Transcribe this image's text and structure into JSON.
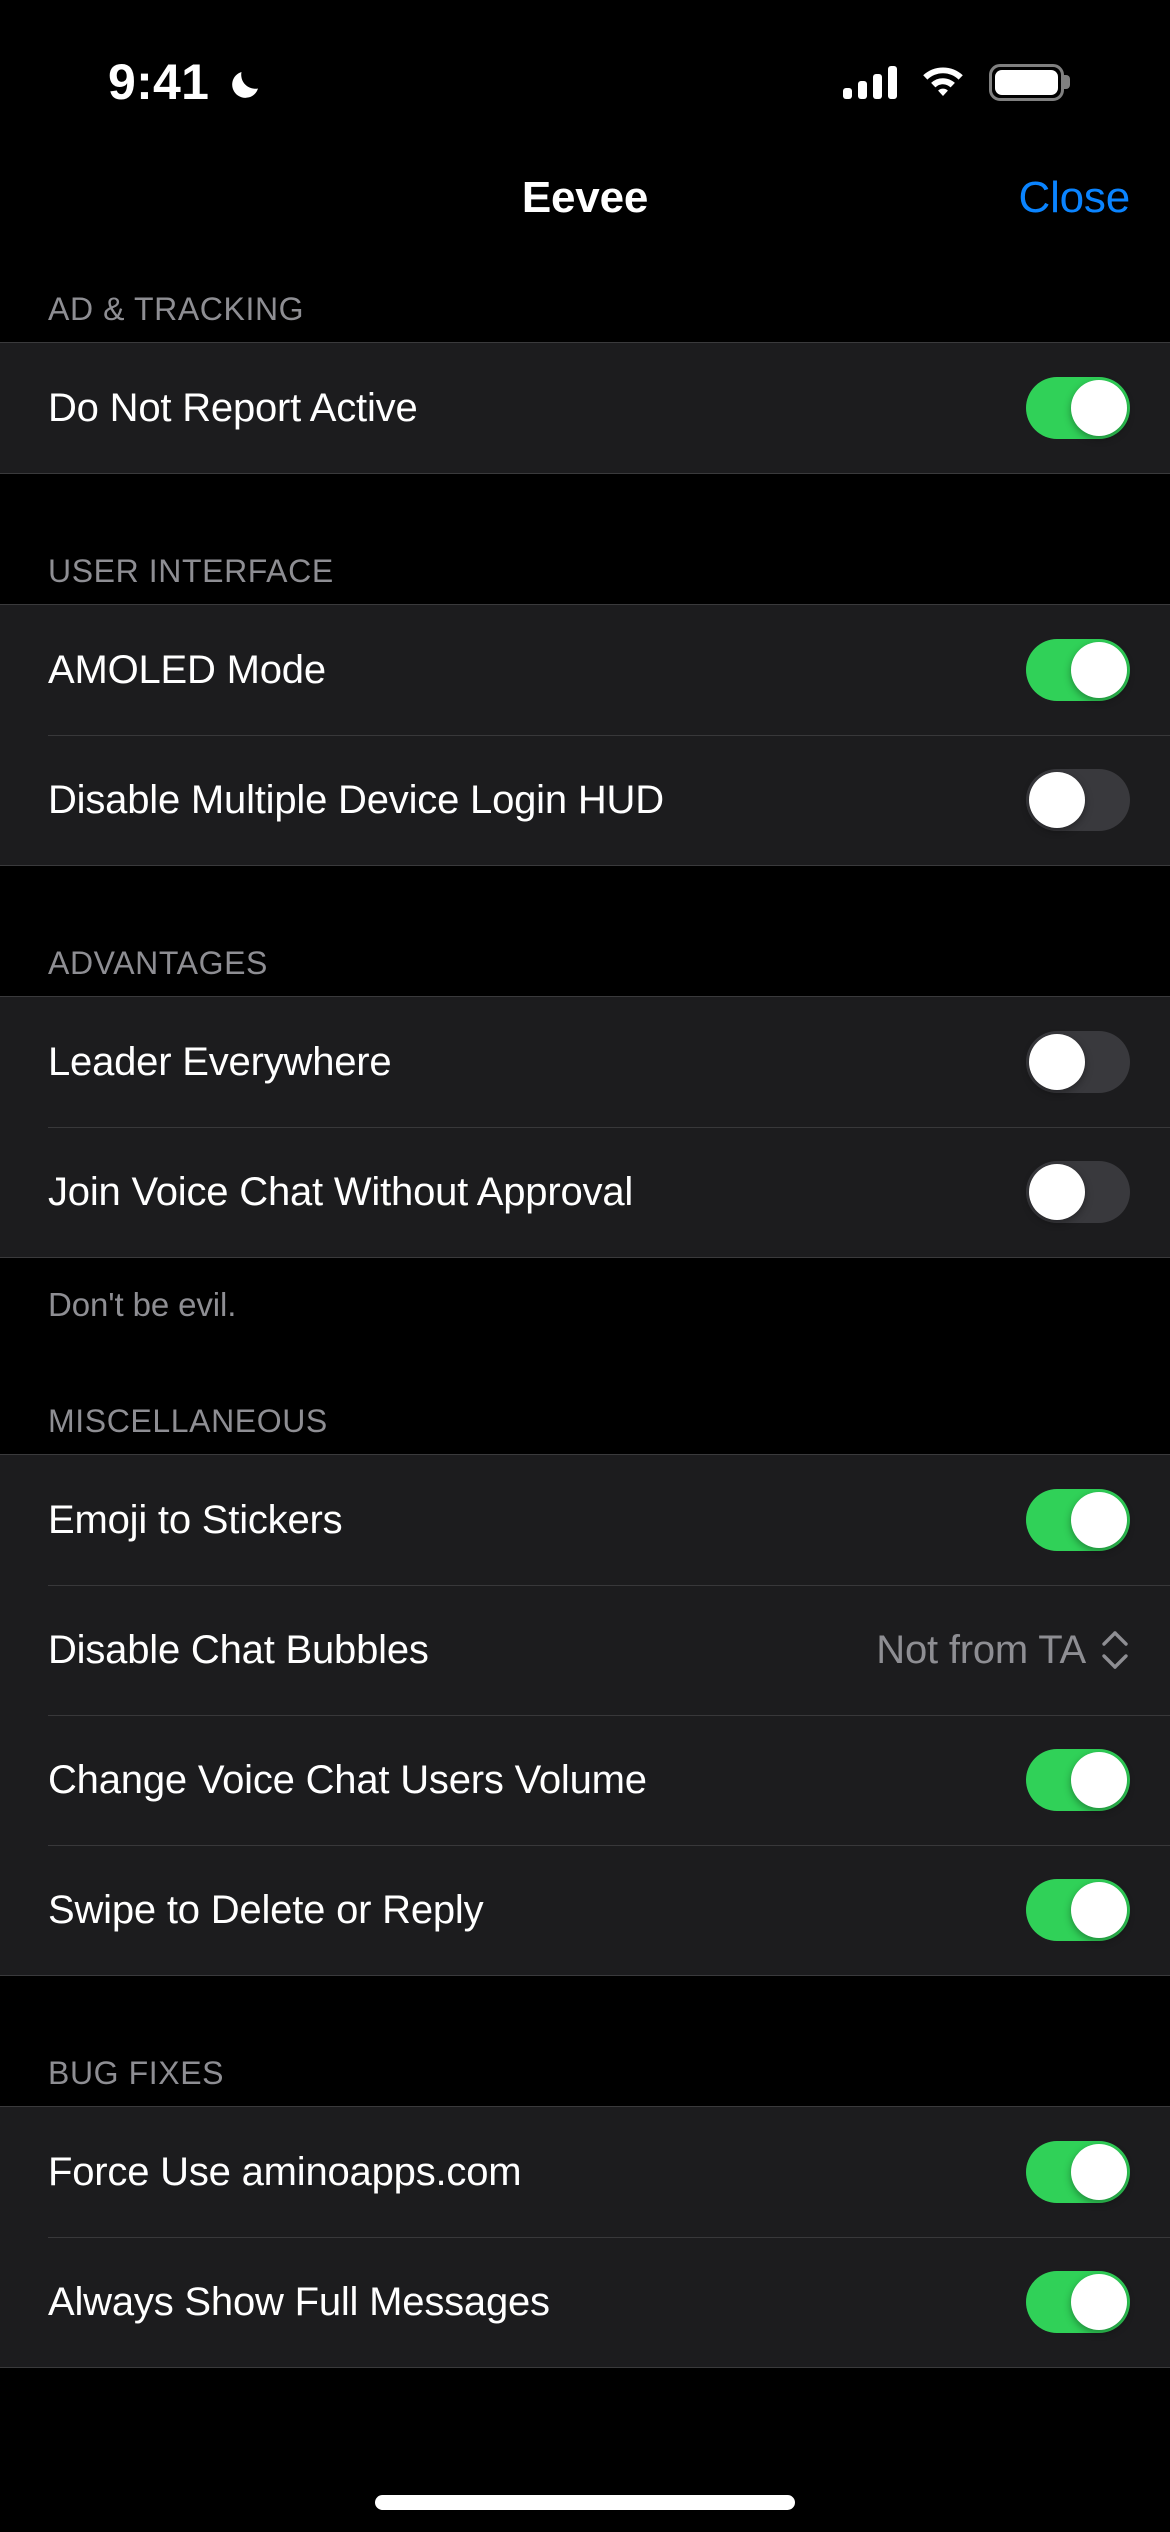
{
  "status_bar": {
    "time": "9:41",
    "dnd_icon": "moon-icon",
    "cellular_icon": "cellular-bars-icon",
    "wifi_icon": "wifi-icon",
    "battery_icon": "battery-full-icon"
  },
  "nav": {
    "title": "Eevee",
    "close_label": "Close"
  },
  "colors": {
    "page_background": "#000000",
    "group_background": "#1C1C1E",
    "separator": "#38383A",
    "accent_blue": "#0A84FF",
    "toggle_on": "#30D158",
    "toggle_off": "#39393D",
    "secondary_text": "#8E8E93",
    "primary_text": "#FFFFFF"
  },
  "sections": [
    {
      "header": "AD & TRACKING",
      "rows": [
        {
          "label": "Do Not Report Active",
          "control": "toggle",
          "value": "on"
        }
      ],
      "footer": ""
    },
    {
      "header": "USER INTERFACE",
      "rows": [
        {
          "label": "AMOLED Mode",
          "control": "toggle",
          "value": "on"
        },
        {
          "label": "Disable Multiple Device Login HUD",
          "control": "toggle",
          "value": "off"
        }
      ],
      "footer": ""
    },
    {
      "header": "ADVANTAGES",
      "rows": [
        {
          "label": "Leader Everywhere",
          "control": "toggle",
          "value": "off"
        },
        {
          "label": "Join Voice Chat Without Approval",
          "control": "toggle",
          "value": "off"
        }
      ],
      "footer": "Don't be evil."
    },
    {
      "header": "MISCELLANEOUS",
      "rows": [
        {
          "label": "Emoji to Stickers",
          "control": "toggle",
          "value": "on"
        },
        {
          "label": "Disable Chat Bubbles",
          "control": "menu",
          "value": "Not from TA"
        },
        {
          "label": "Change Voice Chat Users Volume",
          "control": "toggle",
          "value": "on"
        },
        {
          "label": "Swipe to Delete or Reply",
          "control": "toggle",
          "value": "on"
        }
      ],
      "footer": ""
    },
    {
      "header": "BUG FIXES",
      "rows": [
        {
          "label": "Force Use aminoapps.com",
          "control": "toggle",
          "value": "on"
        },
        {
          "label": "Always Show Full Messages",
          "control": "toggle",
          "value": "on"
        }
      ],
      "footer": ""
    }
  ]
}
